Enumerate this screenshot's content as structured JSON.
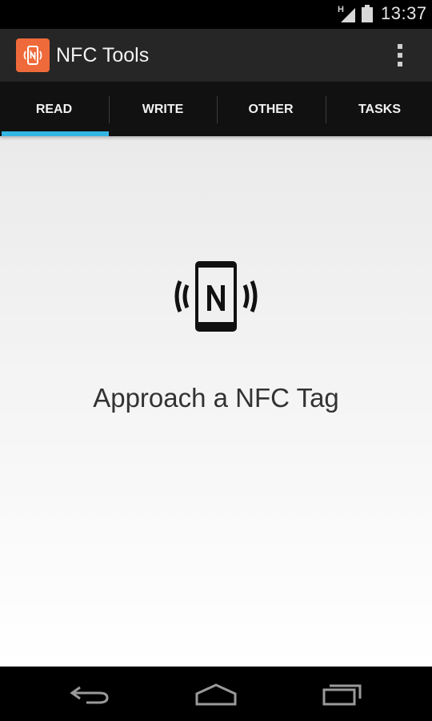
{
  "status_bar": {
    "network_type": "H",
    "time": "13:37",
    "signal_icon": "signal-icon",
    "battery_icon": "battery-icon"
  },
  "action_bar": {
    "app_icon": "nfc-app-icon",
    "title": "NFC Tools",
    "overflow_icon": "overflow-menu-icon"
  },
  "tabs": [
    {
      "label": "READ",
      "selected": true
    },
    {
      "label": "WRITE",
      "selected": false
    },
    {
      "label": "OTHER",
      "selected": false
    },
    {
      "label": "TASKS",
      "selected": false
    }
  ],
  "colors": {
    "accent": "#33b5e5",
    "app_icon_bg": "#ef6a3a",
    "action_bar_bg": "#262626",
    "tab_bar_bg": "#111111"
  },
  "main": {
    "icon": "nfc-phone-icon",
    "message": "Approach a NFC Tag"
  },
  "nav_bar": {
    "back_icon": "back-icon",
    "home_icon": "home-icon",
    "recents_icon": "recent-apps-icon"
  }
}
